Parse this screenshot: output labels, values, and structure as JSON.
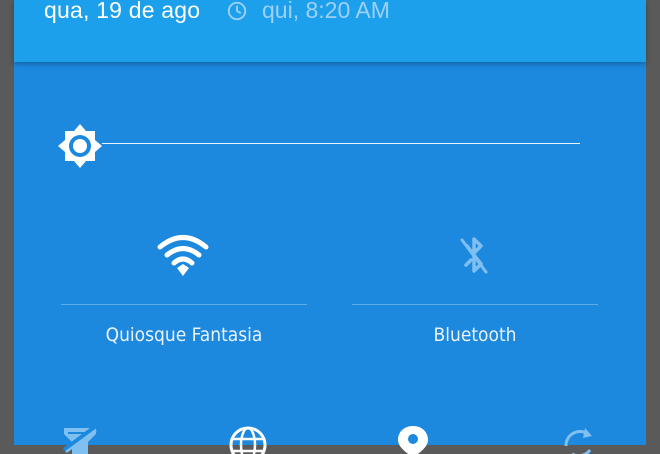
{
  "header": {
    "date": "qua, 19 de ago",
    "alarm_icon": "alarm-clock-icon",
    "alarm_time": "qui, 8:20 AM"
  },
  "brightness": {
    "icon": "brightness-icon",
    "level": 0.0
  },
  "tiles": [
    {
      "label": "Quiosque Fantasia",
      "icon": "wifi-icon",
      "state": "on"
    },
    {
      "label": "Bluetooth",
      "icon": "bluetooth-off-icon",
      "state": "off"
    }
  ],
  "bottom_row_icons": [
    "flashlight-icon",
    "globe-icon",
    "location-icon",
    "auto-rotate-icon"
  ],
  "colors": {
    "panel": "#1c88de",
    "header": "#1ca0ec",
    "icon_active": "#ffffff",
    "icon_inactive": "#7fc0f0"
  }
}
